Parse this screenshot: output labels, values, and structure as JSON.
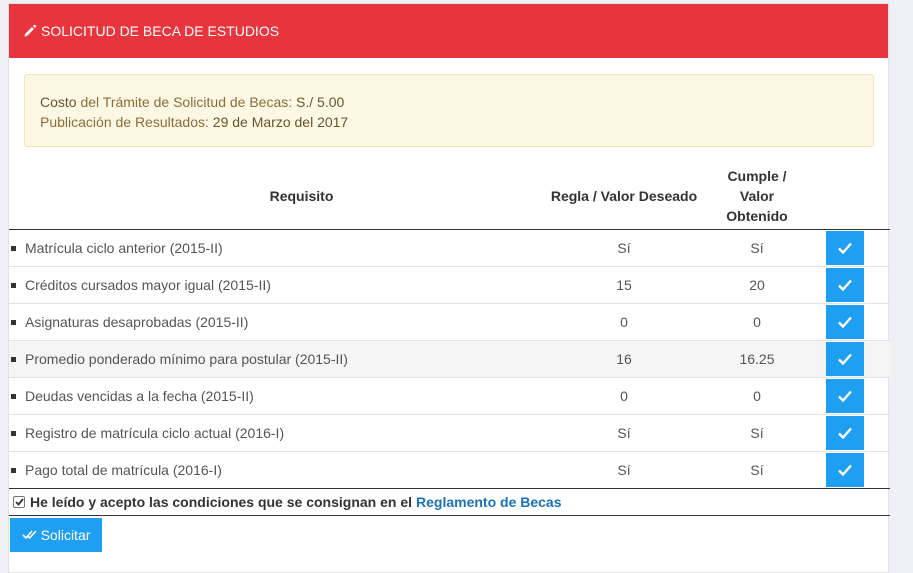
{
  "header": {
    "title": "SOLICITUD DE BECA DE ESTUDIOS",
    "icon": "pencil-icon"
  },
  "info": {
    "cost_label": "Costo",
    "cost_text": " del Trámite de Solicitud de Becas: ",
    "cost_value": "S./ 5.00",
    "pub_text": "Publicación de Resultados: ",
    "pub_value": "29 de Marzo del 2017"
  },
  "table": {
    "headers": {
      "requisito": "Requisito",
      "regla": "Regla / Valor Deseado",
      "cumple_1": "Cumple /",
      "cumple_2": "Valor",
      "cumple_3": "Obtenido"
    },
    "rows": [
      {
        "requisito": "Matrícula ciclo anterior (2015-II)",
        "regla": "Sí",
        "obtenido": "Sí",
        "cumple": true
      },
      {
        "requisito": "Créditos cursados mayor igual (2015-II)",
        "regla": "15",
        "obtenido": "20",
        "cumple": true
      },
      {
        "requisito": "Asignaturas desaprobadas (2015-II)",
        "regla": "0",
        "obtenido": "0",
        "cumple": true
      },
      {
        "requisito": "Promedio ponderado mínimo para postular (2015-II)",
        "regla": "16",
        "obtenido": "16.25",
        "cumple": true
      },
      {
        "requisito": "Deudas vencidas a la fecha (2015-II)",
        "regla": "0",
        "obtenido": "0",
        "cumple": true
      },
      {
        "requisito": "Registro de matrícula ciclo actual (2016-I)",
        "regla": "Sí",
        "obtenido": "Sí",
        "cumple": true
      },
      {
        "requisito": "Pago total de matrícula (2016-I)",
        "regla": "Sí",
        "obtenido": "Sí",
        "cumple": true
      }
    ]
  },
  "accept": {
    "checked": true,
    "text": "He leído y acepto las condiciones que se consignan en el",
    "link": "Reglamento de Becas"
  },
  "submit_label": "Solicitar",
  "colors": {
    "header": "#e8343d",
    "accent": "#1e9ff2",
    "link": "#1a73b8"
  }
}
